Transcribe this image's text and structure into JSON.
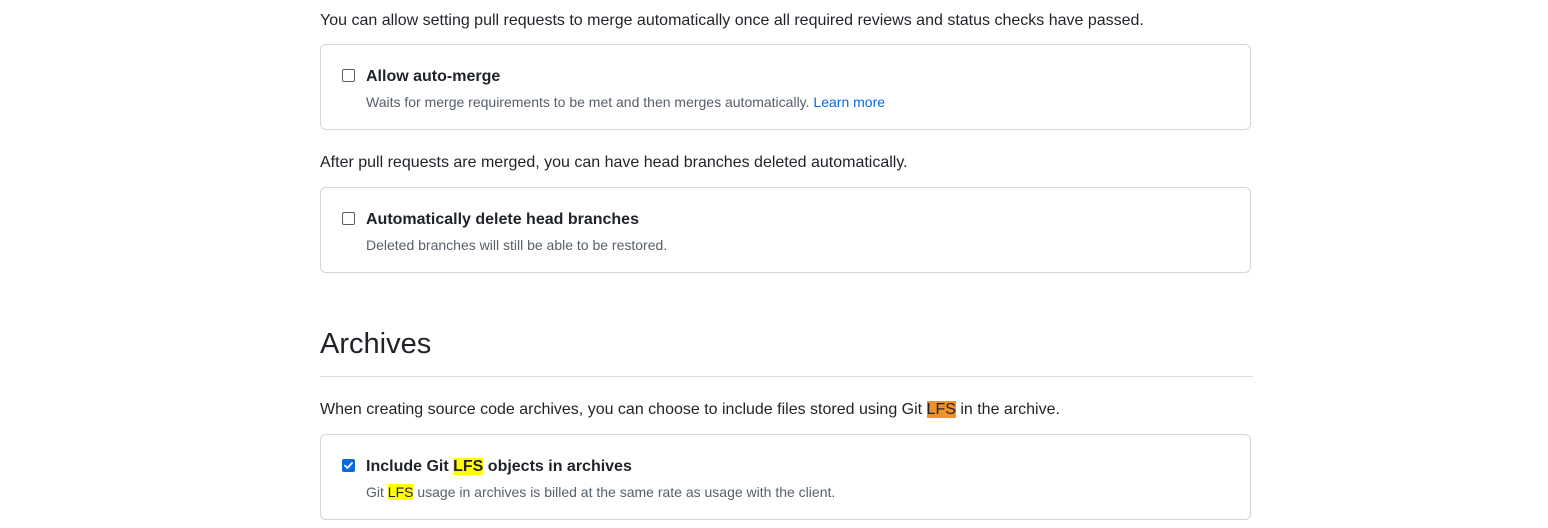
{
  "pull_requests": {
    "auto_merge_intro": "You can allow setting pull requests to merge automatically once all required reviews and status checks have passed.",
    "auto_merge": {
      "label": "Allow auto-merge",
      "checked": false,
      "description": "Waits for merge requirements to be met and then merges automatically.",
      "link_text": "Learn more"
    },
    "delete_branches_intro": "After pull requests are merged, you can have head branches deleted automatically.",
    "delete_branches": {
      "label": "Automatically delete head branches",
      "checked": false,
      "description": "Deleted branches will still be able to be restored."
    }
  },
  "archives": {
    "heading": "Archives",
    "intro_before": "When creating source code archives, you can choose to include files stored using Git ",
    "intro_highlight": "LFS",
    "intro_after": " in the archive.",
    "include_lfs": {
      "label_before": "Include Git ",
      "label_highlight": "LFS",
      "label_after": " objects in archives",
      "checked": true,
      "description_before": "Git ",
      "description_highlight": "LFS",
      "description_after": " usage in archives is billed at the same rate as usage with the client."
    }
  },
  "colors": {
    "accent": "#0969da",
    "border": "#d0d7de",
    "highlight_current": "#f0922b",
    "highlight_match": "#ffff00"
  }
}
